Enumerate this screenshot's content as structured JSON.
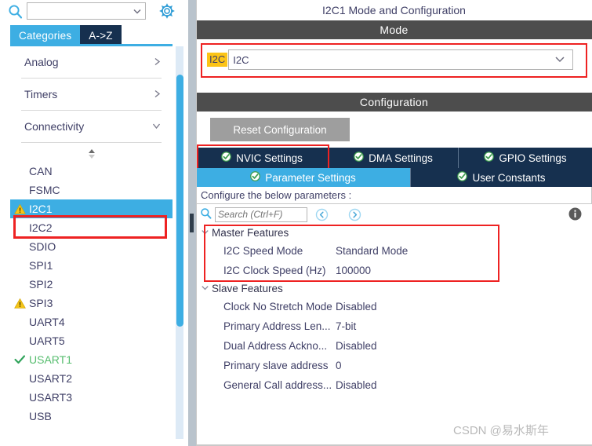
{
  "left_panel": {
    "search": {
      "value": "",
      "placeholder": ""
    },
    "icons": {
      "search": "search-icon",
      "dropdown": "chevron-down-icon",
      "settings": "gear-icon",
      "sort": "sort-arrows-icon"
    },
    "tabs": [
      {
        "label": "Categories",
        "active": true
      },
      {
        "label": "A->Z",
        "active": false
      }
    ],
    "categories": [
      {
        "label": "Analog",
        "expanded": false,
        "chevron": "chevron-right-icon"
      },
      {
        "label": "Timers",
        "expanded": false,
        "chevron": "chevron-right-icon"
      },
      {
        "label": "Connectivity",
        "expanded": true,
        "chevron": "chevron-down-icon"
      }
    ],
    "peripherals": [
      {
        "label": "CAN",
        "status": "none",
        "selected": false
      },
      {
        "label": "FSMC",
        "status": "none",
        "selected": false
      },
      {
        "label": "I2C1",
        "status": "warning",
        "selected": true
      },
      {
        "label": "I2C2",
        "status": "none",
        "selected": false
      },
      {
        "label": "SDIO",
        "status": "none",
        "selected": false
      },
      {
        "label": "SPI1",
        "status": "none",
        "selected": false
      },
      {
        "label": "SPI2",
        "status": "none",
        "selected": false
      },
      {
        "label": "SPI3",
        "status": "warning",
        "selected": false
      },
      {
        "label": "UART4",
        "status": "none",
        "selected": false
      },
      {
        "label": "UART5",
        "status": "none",
        "selected": false
      },
      {
        "label": "USART1",
        "status": "ok",
        "selected": false
      },
      {
        "label": "USART2",
        "status": "none",
        "selected": false
      },
      {
        "label": "USART3",
        "status": "none",
        "selected": false
      },
      {
        "label": "USB",
        "status": "none",
        "selected": false
      }
    ]
  },
  "right_panel": {
    "title": "I2C1 Mode and Configuration",
    "mode_band": "Mode",
    "mode": {
      "chip_label": "I2C",
      "selected_value": "I2C",
      "chevron": "chevron-down-icon"
    },
    "configuration_band": "Configuration",
    "reset_button": "Reset Configuration",
    "tabs_row1": [
      {
        "label": "NVIC Settings",
        "active": false,
        "badge": "green-check-icon"
      },
      {
        "label": "DMA Settings",
        "active": false,
        "badge": "green-check-icon"
      },
      {
        "label": "GPIO Settings",
        "active": false,
        "badge": "green-check-icon"
      }
    ],
    "tabs_row2": [
      {
        "label": "Parameter Settings",
        "active": true,
        "badge": "green-check-icon"
      },
      {
        "label": "User Constants",
        "active": false,
        "badge": "green-check-icon"
      }
    ],
    "configure_hint": "Configure the below parameters :",
    "param_search": {
      "value": "",
      "placeholder": "Search (Ctrl+F)"
    },
    "nav_prev": "prev-circle-icon",
    "nav_next": "next-circle-icon",
    "info": "info-icon",
    "groups": [
      {
        "name": "Master Features",
        "expanded": true,
        "rows": [
          {
            "name": "I2C Speed Mode",
            "value": "Standard Mode"
          },
          {
            "name": "I2C Clock Speed (Hz)",
            "value": "100000"
          }
        ]
      },
      {
        "name": "Slave Features",
        "expanded": true,
        "rows": [
          {
            "name": "Clock No Stretch Mode",
            "value": "Disabled"
          },
          {
            "name": "Primary Address Len...",
            "value": "7-bit"
          },
          {
            "name": "Dual Address Ackno...",
            "value": "Disabled"
          },
          {
            "name": "Primary slave address",
            "value": "0"
          },
          {
            "name": "General Call address...",
            "value": "Disabled"
          }
        ]
      }
    ]
  },
  "watermark": "CSDN @易水斯年",
  "colors": {
    "accent_blue": "#3daee3",
    "dark_navy": "#16304f",
    "band_gray": "#4d4d4d",
    "highlight_red": "#ee2222",
    "chip_yellow": "#fcc417",
    "ok_green": "#56bd6e",
    "warn_yellow": "#f5c518"
  }
}
